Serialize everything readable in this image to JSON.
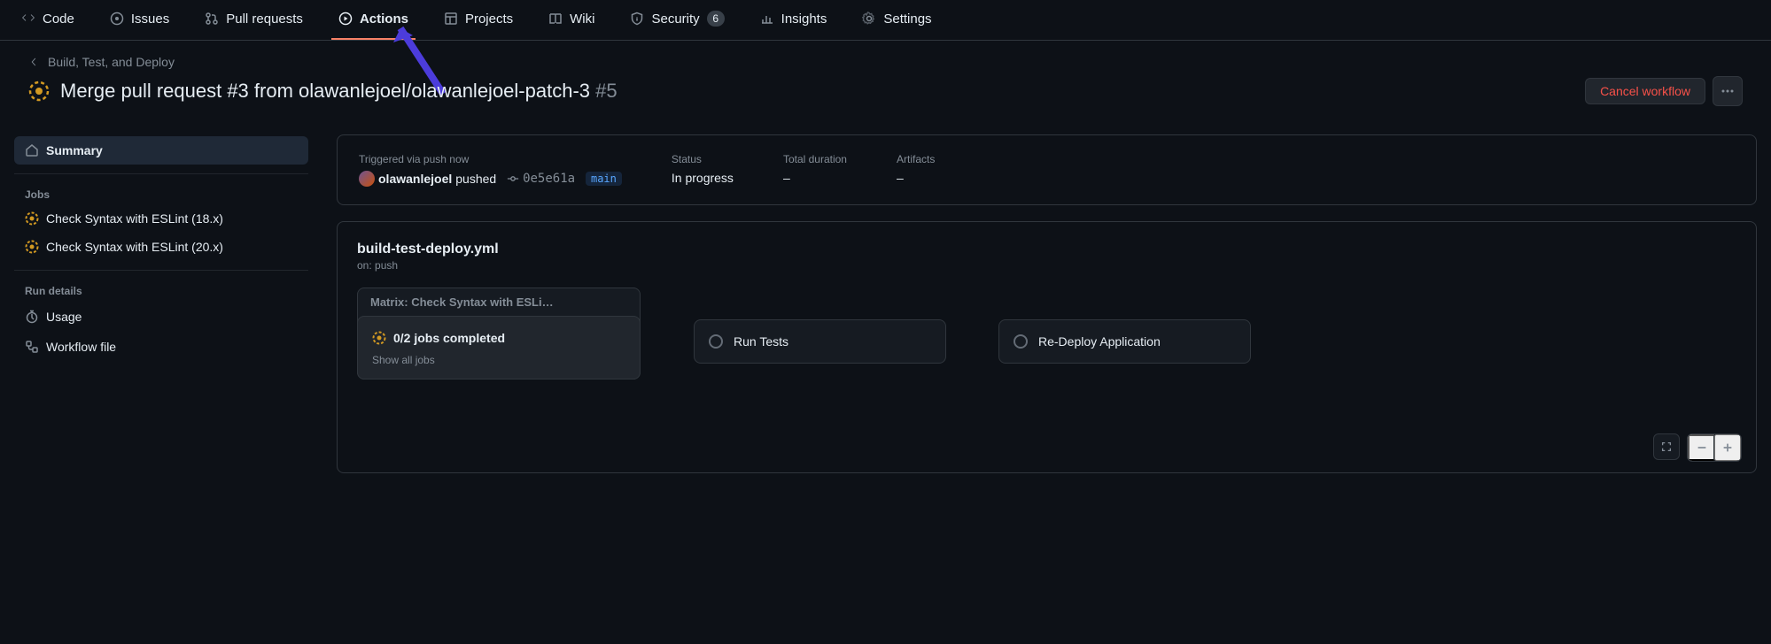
{
  "nav": {
    "code": "Code",
    "issues": "Issues",
    "pull_requests": "Pull requests",
    "actions": "Actions",
    "projects": "Projects",
    "wiki": "Wiki",
    "security": "Security",
    "security_count": "6",
    "insights": "Insights",
    "settings": "Settings"
  },
  "back_link": "Build, Test, and Deploy",
  "run": {
    "title": "Merge pull request #3 from olawanlejoel/olawanlejoel-patch-3",
    "number": "#5",
    "cancel_label": "Cancel workflow"
  },
  "sidebar": {
    "summary": "Summary",
    "jobs_heading": "Jobs",
    "job1": "Check Syntax with ESLint (18.x)",
    "job2": "Check Syntax with ESLint (20.x)",
    "run_details_heading": "Run details",
    "usage": "Usage",
    "workflow_file": "Workflow file"
  },
  "summary": {
    "triggered_label": "Triggered via push now",
    "author": "olawanlejoel",
    "pushed": "pushed",
    "sha": "0e5e61a",
    "branch": "main",
    "status_label": "Status",
    "status_value": "In progress",
    "duration_label": "Total duration",
    "duration_value": "–",
    "artifacts_label": "Artifacts",
    "artifacts_value": "–"
  },
  "graph": {
    "file": "build-test-deploy.yml",
    "trigger": "on: push",
    "matrix_label": "Matrix: Check Syntax with ESLi…",
    "matrix_status": "0/2 jobs completed",
    "show_all": "Show all jobs",
    "run_tests": "Run Tests",
    "redeploy": "Re-Deploy Application"
  }
}
